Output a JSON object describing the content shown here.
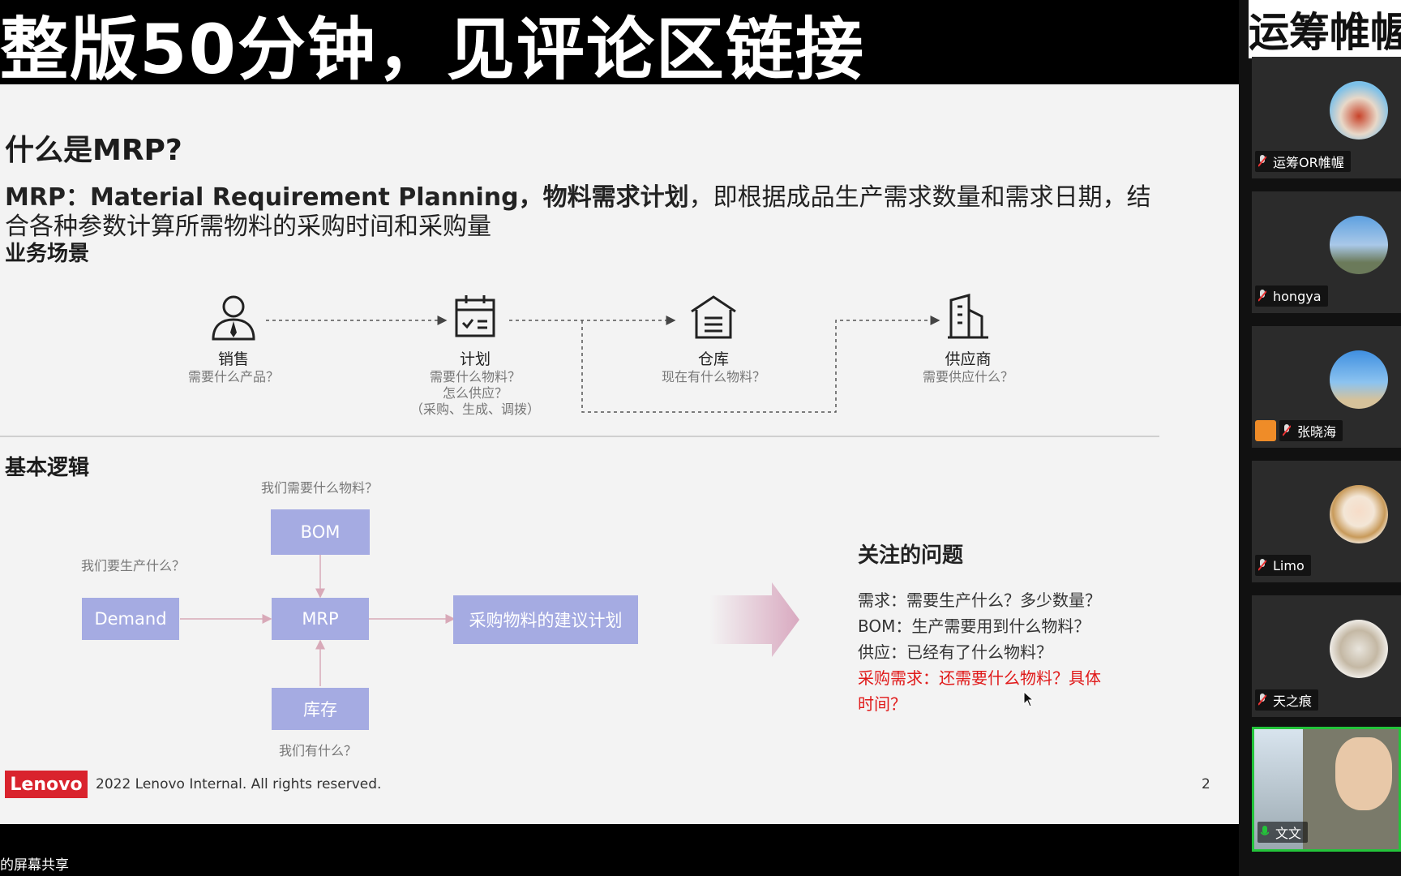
{
  "banner": "整版50分钟，见评论区链接",
  "brand": "运筹帷幄",
  "slide": {
    "title": "什么是MRP?",
    "intro_bold1": "MRP：Material Requirement Planning，",
    "intro_bold2": "物料需求计划",
    "intro_rest": "，即根据成品生产需求数量和需求日期，结合各种参数计算所需物料的采购时间和采购量",
    "section1": "业务场景",
    "flow": [
      {
        "name": "销售",
        "sub": [
          "需要什么产品？"
        ],
        "icon": "salesperson-icon"
      },
      {
        "name": "计划",
        "sub": [
          "需要什么物料？",
          "怎么供应？",
          "（采购、生成、调拨）"
        ],
        "icon": "calendar-plan-icon"
      },
      {
        "name": "仓库",
        "sub": [
          "现在有什么物料？"
        ],
        "icon": "warehouse-icon"
      },
      {
        "name": "供应商",
        "sub": [
          "需要供应什么？"
        ],
        "icon": "building-icon"
      }
    ],
    "section2": "基本逻辑",
    "logic": {
      "bom_note": "我们需要什么物料？",
      "demand_note": "我们要生产什么？",
      "stock_note": "我们有什么？",
      "bom": "BOM",
      "demand": "Demand",
      "mrp": "MRP",
      "stock": "库存",
      "output": "采购物料的建议计划"
    },
    "focus": {
      "title": "关注的问题",
      "q1": "需求：需要生产什么？多少数量？",
      "q2": "BOM：生产需要用到什么物料？",
      "q3": "供应：已经有了什么物料？",
      "q4a": "采购需求：还需要什么物料？具体",
      "q4b": "时间？"
    },
    "footer_logo": "Lenovo",
    "footer_text": "2022 Lenovo Internal. All rights reserved.",
    "page": "2"
  },
  "share_label": "的屏幕共享",
  "participants": [
    {
      "name": "运筹OR帷幄"
    },
    {
      "name": "hongya"
    },
    {
      "name": "张晓海"
    },
    {
      "name": "Limo"
    },
    {
      "name": "天之痕"
    },
    {
      "name": "文文"
    }
  ],
  "colors": {
    "box": "#a5abe2",
    "red": "#e01a1a",
    "lenovo": "#d9232d",
    "active_border": "#23c43a"
  }
}
